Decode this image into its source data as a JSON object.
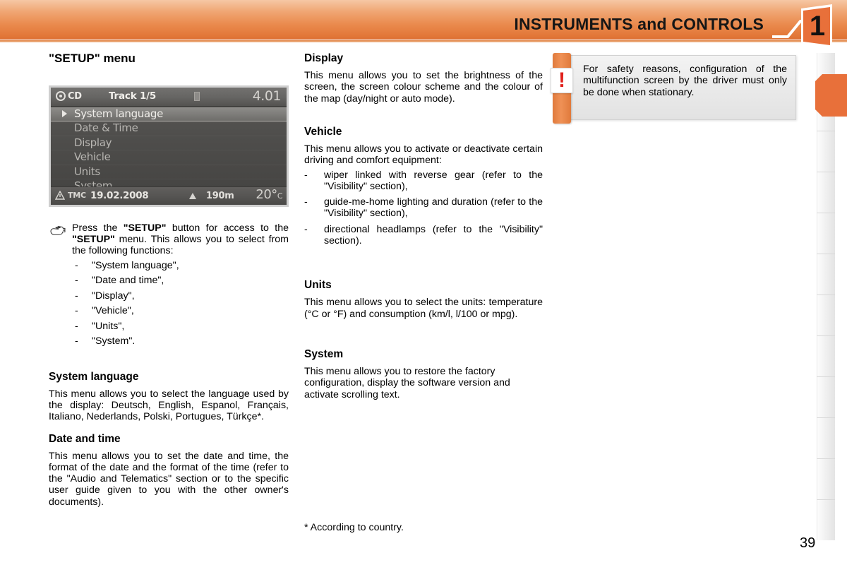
{
  "header": {
    "title": "INSTRUMENTS and CONTROLS",
    "chapter_number": "1",
    "band_color": "#e8893f",
    "accent_color": "#e8703a"
  },
  "left_column": {
    "heading": "\"SETUP\" menu",
    "display": {
      "top_bar": {
        "source_icon": "cd-disc-icon",
        "source_label": "CD",
        "track": "Track 1/5",
        "center_icon": "battery-icon",
        "time": "4.01"
      },
      "menu_items": [
        {
          "label": "System language",
          "selected": true
        },
        {
          "label": "Date & Time",
          "selected": false
        },
        {
          "label": "Display",
          "selected": false
        },
        {
          "label": "Vehicle",
          "selected": false
        },
        {
          "label": "Units",
          "selected": false
        },
        {
          "label": "System",
          "selected": false
        }
      ],
      "bottom_bar": {
        "tmc_label": "TMC",
        "date": "19.02.2008",
        "altitude": "190m",
        "temperature": "20°",
        "temperature_unit": "C"
      }
    },
    "instruction": {
      "icon": "pointing-hand-icon",
      "text_part1": "Press the ",
      "bold1": "\"SETUP\"",
      "text_part2": " button for access to the ",
      "bold2": "\"SETUP\"",
      "text_part3": " menu. This allows you to select from the following functions:",
      "options": [
        "\"System language\",",
        "\"Date and time\",",
        "\"Display\",",
        "\"Vehicle\",",
        "\"Units\",",
        "\"System\"."
      ]
    },
    "sections": [
      {
        "heading": "System language",
        "body": "This menu allows you to select the language used by the display: Deutsch, English, Espanol, Français, Italiano, Nederlands, Polski, Portugues, Türkçe*."
      },
      {
        "heading": "Date and time",
        "body": "This menu allows you to set the date and time, the format of the date and the format of the time (refer to the \"Audio and Telematics\" section or to the specific user guide given to you with the other owner's documents)."
      }
    ]
  },
  "mid_column": {
    "sections": [
      {
        "heading": "Display",
        "body": "This menu allows you to set the brightness of the screen, the screen colour scheme and the colour of the map (day/night or auto mode).",
        "list": []
      },
      {
        "heading": "Vehicle",
        "body": "This menu allows you to activate or deactivate certain driving and comfort equipment:",
        "list": [
          "wiper linked with reverse gear (refer to the \"Visibility\" section),",
          "guide-me-home lighting and duration (refer to the \"Visibility\" section),",
          "directional headlamps (refer to the \"Visibility\" section)."
        ]
      },
      {
        "heading": "Units",
        "body": "This menu allows you to select the units: temperature (°C or °F) and consumption (km/l, l/100 or mpg).",
        "list": []
      },
      {
        "heading": "System",
        "body": "This menu allows you to restore the factory configuration, display the software version and activate scrolling text.",
        "list": []
      }
    ],
    "footnote": "* According to country."
  },
  "right_column": {
    "warning": {
      "icon": "exclamation-icon",
      "text": "For safety reasons, configuration of the multifunction screen by the driver must only be done when stationary."
    }
  },
  "page": {
    "number": "39"
  }
}
